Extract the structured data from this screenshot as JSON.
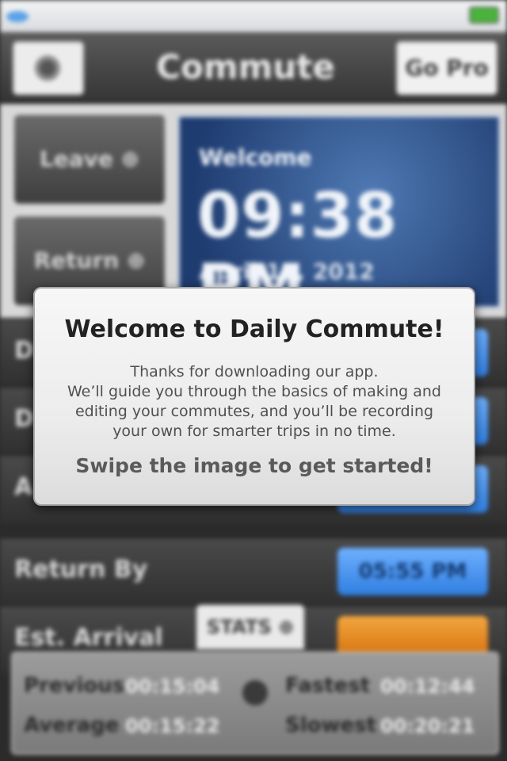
{
  "app": {
    "title": "Commute",
    "go_pro_label": "Go Pro"
  },
  "colors": {
    "accent_blue": "#2f7ee0",
    "accent_orange": "#d26a06",
    "clock_bg": "#1f3c70",
    "dialog_bg": "#ececec"
  },
  "actions": {
    "leave_label": "Leave ⊕",
    "return_label": "Return ⊕"
  },
  "clock": {
    "greeting": "Welcome",
    "time": "09:38 PM",
    "date": "April 17, 2012"
  },
  "rows": [
    {
      "label": "D",
      "value": ""
    },
    {
      "label": "D",
      "value": ""
    },
    {
      "label": "A",
      "value": ""
    },
    {
      "label": "Return By",
      "value": "05:55 PM"
    },
    {
      "label": "Est. Arrival",
      "value": ""
    }
  ],
  "stats": {
    "tab_label": "STATS ⊕",
    "previous_label": "Previous",
    "previous_value": "00:15:04",
    "fastest_label": "Fastest",
    "fastest_value": "00:12:44",
    "average_label": "Average",
    "average_value": "00:15:22",
    "slowest_label": "Slowest",
    "slowest_value": "00:20:21"
  },
  "dialog": {
    "title": "Welcome to Daily Commute!",
    "body_lines": [
      "Thanks for downloading our app.",
      "We’ll guide you through the basics of making and",
      "editing your commutes, and you’ll be recording",
      "your own for smarter trips in no time."
    ],
    "cta": "Swipe the image to get started!"
  },
  "icons": {
    "settings": "gear-icon",
    "battery": "battery-icon",
    "stats": "stopwatch-icon"
  }
}
